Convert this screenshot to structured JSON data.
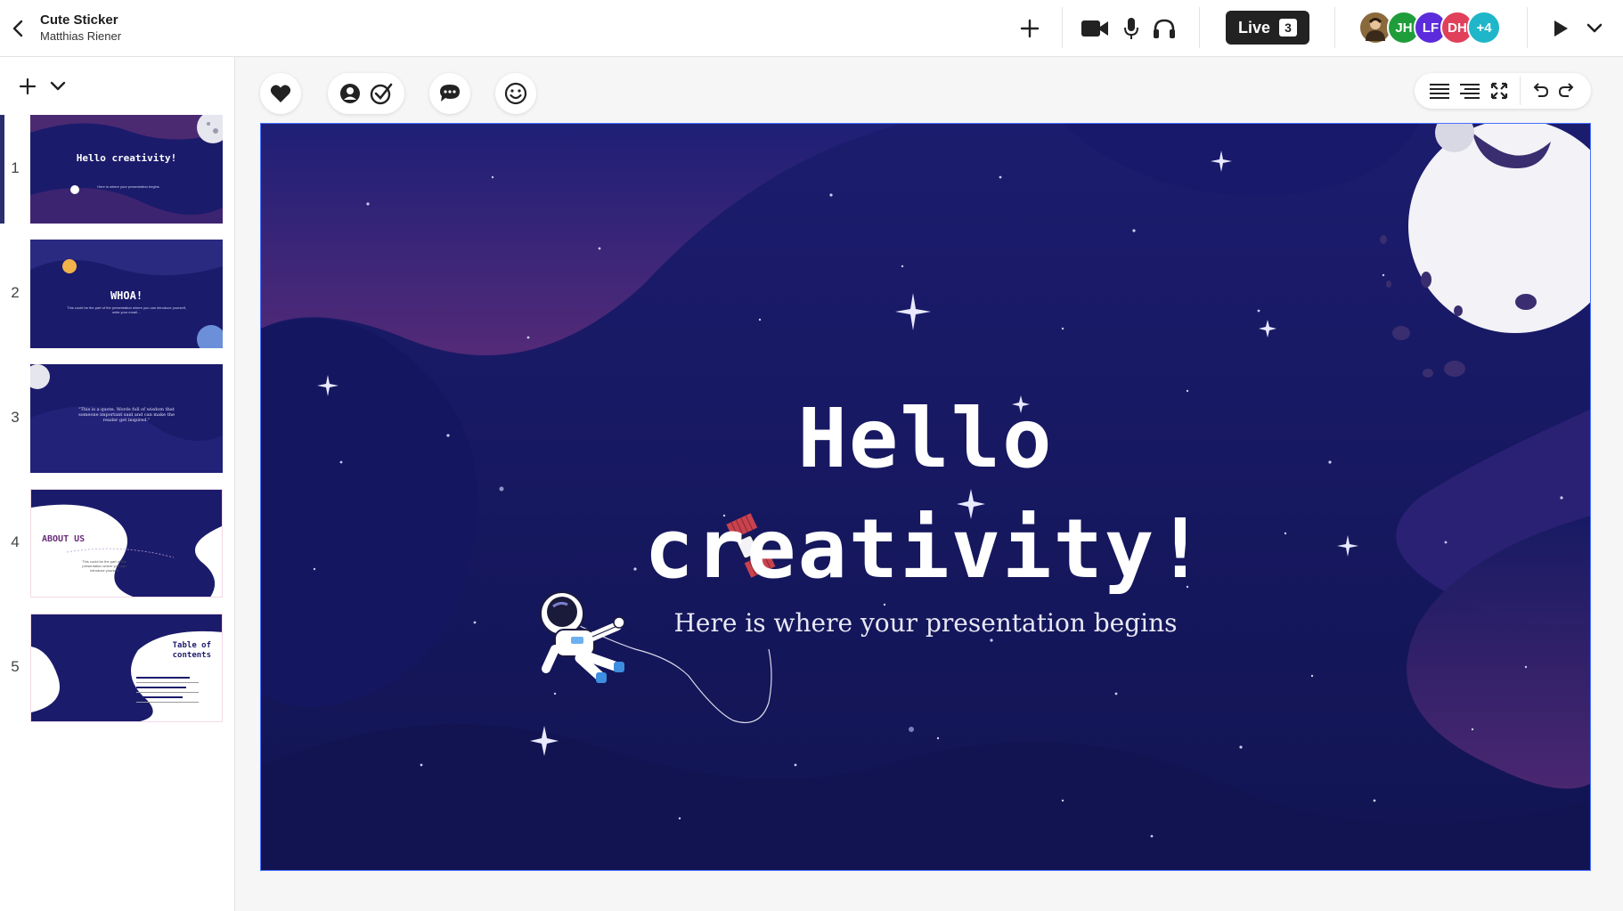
{
  "app": {
    "doc_title": "Cute Sticker",
    "doc_owner": "Matthias Riener"
  },
  "toolbar": {
    "live_label": "Live",
    "live_count": "3",
    "collaborators": [
      {
        "initials": "",
        "color": "#8a6a3c"
      },
      {
        "initials": "JH",
        "color": "#1f9d3a"
      },
      {
        "initials": "LF",
        "color": "#5b2bdc"
      },
      {
        "initials": "DH",
        "color": "#e0405a"
      },
      {
        "initials": "+4",
        "color": "#1fb6c9"
      }
    ],
    "icons": [
      "back-icon",
      "plus-icon",
      "video-camera-icon",
      "microphone-icon",
      "headphones-icon",
      "play-icon",
      "chevron-down-icon"
    ]
  },
  "slides_panel": {
    "slides": [
      {
        "number": "1",
        "title": "Hello creativity!",
        "subtitle": "Here is where your presentation begins",
        "selected": true
      },
      {
        "number": "2",
        "title": "WHOA!",
        "subtitle": "This could be the part of the presentation where you can introduce yourself, write your email…"
      },
      {
        "number": "3",
        "title": "",
        "subtitle": "\"This is a quote. Words full of wisdom that someone important said and can make the reader get inspired.\""
      },
      {
        "number": "4",
        "title": "ABOUT US",
        "subtitle": "This could be the part of the presentation where you can introduce yourself"
      },
      {
        "number": "5",
        "title": "Table of contents",
        "subtitle": ""
      }
    ]
  },
  "slide": {
    "title_line1": "Hello",
    "title_line2": "creativity!",
    "subtitle": "Here is where your presentation begins",
    "bg_color": "#1a1a6e",
    "accent_color": "#6b2f7a"
  }
}
